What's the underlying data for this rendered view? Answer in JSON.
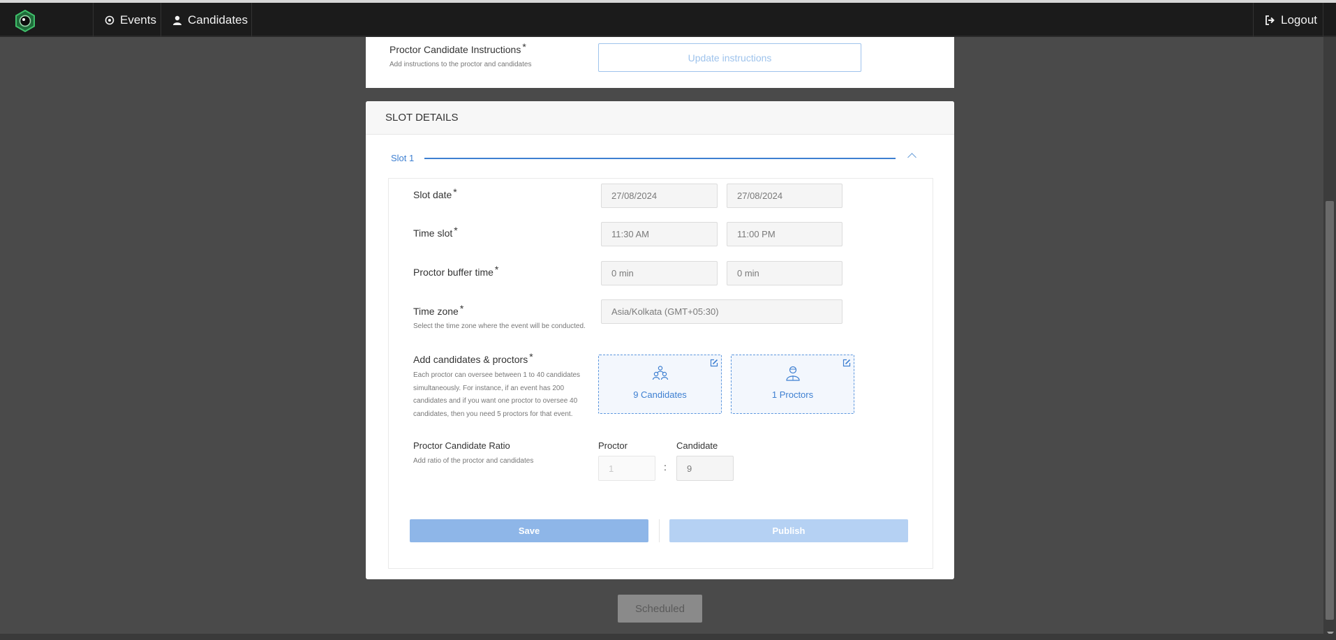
{
  "nav": {
    "events_label": "Events",
    "candidates_label": "Candidates",
    "logout_label": "Logout"
  },
  "instructions": {
    "label": "Proctor Candidate Instructions",
    "required": "*",
    "hint": "Add instructions to the proctor and candidates",
    "button_label": "Update instructions"
  },
  "slot_details": {
    "header": "SLOT DETAILS",
    "tab_label": "Slot 1",
    "slot_date": {
      "label": "Slot date",
      "start": "27/08/2024",
      "end": "27/08/2024"
    },
    "time_slot": {
      "label": "Time slot",
      "start": "11:30 AM",
      "end": "11:00 PM"
    },
    "buffer": {
      "label": "Proctor buffer time",
      "before": "0 min",
      "after": "0 min"
    },
    "time_zone": {
      "label": "Time zone",
      "hint": "Select the time zone where the event will be conducted.",
      "value": "Asia/Kolkata (GMT+05:30)"
    },
    "add_people": {
      "label": "Add candidates & proctors",
      "hint_lines": [
        "Each proctor can oversee between 1 to 40 candidates",
        "simultaneously. For instance, if an event has 200",
        "candidates and if you want one proctor to oversee 40",
        "candidates, then you need 5 proctors for that event."
      ],
      "candidates_tile": "9 Candidates",
      "proctors_tile": "1 Proctors"
    },
    "ratio": {
      "label": "Proctor Candidate Ratio",
      "hint": "Add ratio of the proctor and candidates",
      "proctor_heading": "Proctor",
      "candidate_heading": "Candidate",
      "proctor_value": "1",
      "candidate_value": "9",
      "separator": ":"
    },
    "save_label": "Save",
    "publish_label": "Publish"
  },
  "scheduled_label": "Scheduled",
  "icons": {
    "events": "target-icon",
    "candidates": "user-icon",
    "logout": "logout-icon",
    "tile_candidates": "group-icon",
    "tile_proctors": "proctor-icon",
    "edit": "edit-icon"
  },
  "colors": {
    "accent": "#3d7fd1",
    "topbar": "#1b1b1b",
    "backdrop": "#4a4a4a"
  }
}
